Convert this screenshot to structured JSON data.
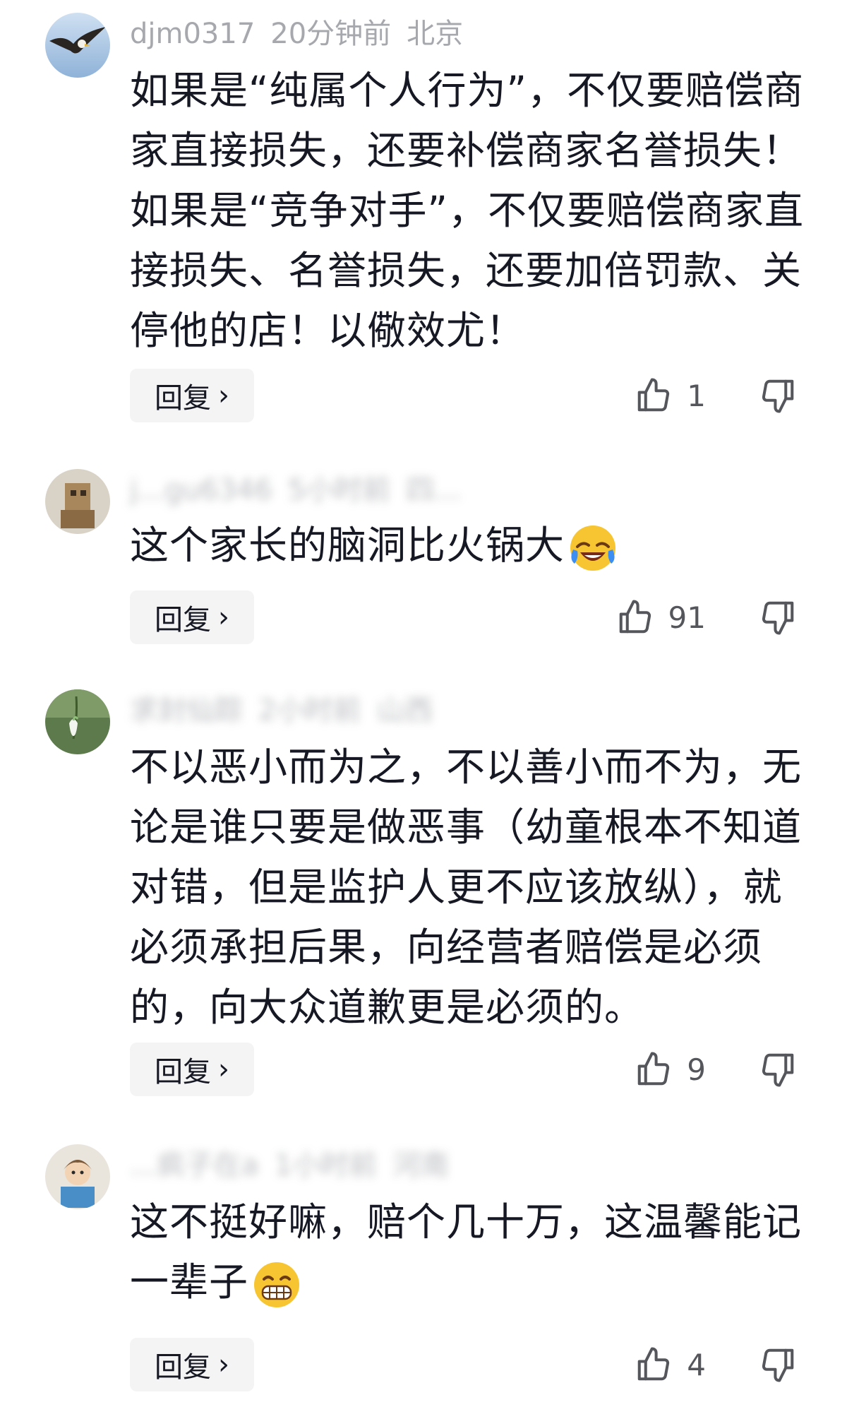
{
  "comments": [
    {
      "user": "djm0317",
      "time": "20分钟前",
      "location": "北京",
      "text": "如果是“纯属个人行为”，不仅要赔偿商家直接损失，还要补偿商家名誉损失！如果是“竞争对手”，不仅要赔偿商家直接损失、名誉损失，还要加倍罚款、关停他的店！以儆效尤！",
      "reply_label": "回复",
      "likes": "1",
      "avatar_icon": "eagle-avatar"
    },
    {
      "user": "j...gu6346",
      "time": "5小时前",
      "location": "四...",
      "text": "这个家长的脑洞比火锅大",
      "emoji": "laughing-crying-emoji",
      "reply_label": "回复",
      "likes": "91",
      "avatar_icon": "figure-avatar"
    },
    {
      "user": "求封仙踪",
      "time": "2小时前",
      "location": "山西",
      "text": "不以恶小而为之，不以善小而不为，无论是谁只要是做恶事（幼童根本不知道对错，但是监护人更不应该放纵），就必须承担后果，向经营者赔偿是必须的，向大众道歉更是必须的。",
      "reply_label": "回复",
      "likes": "9",
      "avatar_icon": "snowdrop-flower-avatar"
    },
    {
      "user": "...疯子在a",
      "time": "1小时前",
      "location": "河南",
      "text": "这不挺好嘛，赔个几十万，这温馨能记一辈子",
      "emoji": "grinning-emoji",
      "reply_label": "回复",
      "likes": "4",
      "avatar_icon": "cartoon-avatar"
    }
  ],
  "colors": {
    "text": "#161823",
    "meta": "#a6a8ad",
    "reply_bg": "#f4f4f5",
    "icon": "#54565c"
  }
}
